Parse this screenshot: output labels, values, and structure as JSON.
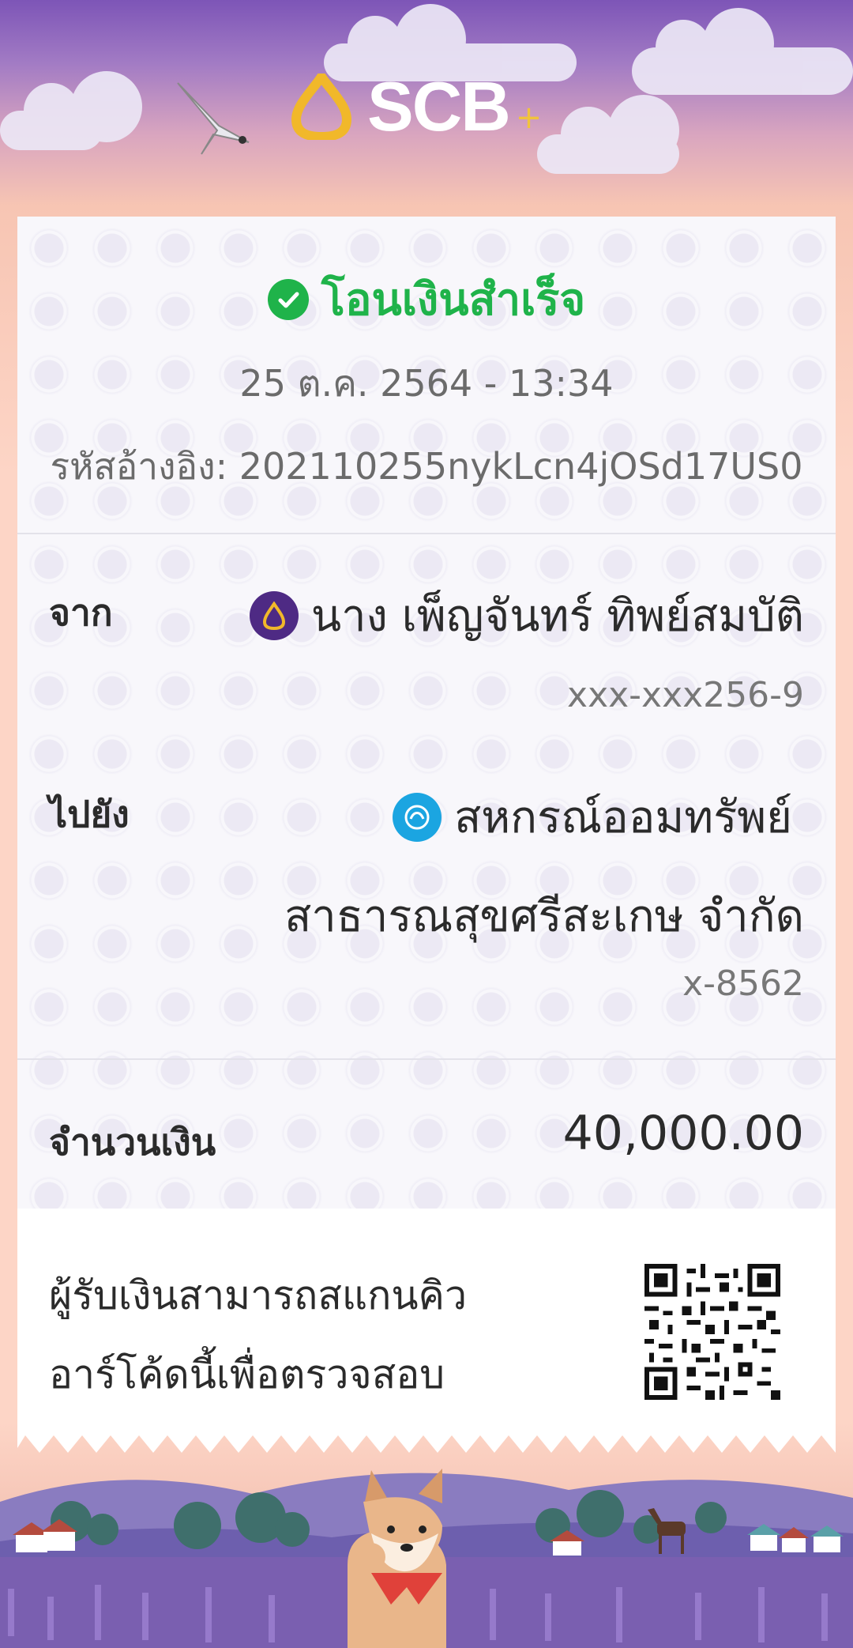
{
  "brand": {
    "name": "SCB",
    "plus": "+"
  },
  "status": {
    "title": "โอนเงินสำเร็จ",
    "icon": "check-circle-icon",
    "color": "#1fb34a"
  },
  "transaction": {
    "datetime": "25 ต.ค. 2564 - 13:34",
    "ref_label": "รหัสอ้างอิง:",
    "ref_value": "202110255nykLcn4jOSd17US0"
  },
  "from": {
    "label": "จาก",
    "name": "นาง เพ็ญจันทร์ ทิพย์สมบัติ",
    "account": "xxx-xxx256-9",
    "bank_icon": "scb-bank-icon",
    "bank_color": "#4e2a84"
  },
  "to": {
    "label": "ไปยัง",
    "name_line1": "สหกรณ์ออมทรัพย์",
    "name_line2": "สาธารณสุขศรีสะเกษ จำกัด",
    "account": "x-8562",
    "bank_icon": "krungthai-bank-icon",
    "bank_color": "#1ba5e1"
  },
  "amount": {
    "label": "จำนวนเงิน",
    "value": "40,000.00"
  },
  "footer": {
    "line1": "ผู้รับเงินสามารถสแกนคิว",
    "line2": "อาร์โค้ดนี้เพื่อตรวจสอบ",
    "qr_icon": "qr-code"
  }
}
